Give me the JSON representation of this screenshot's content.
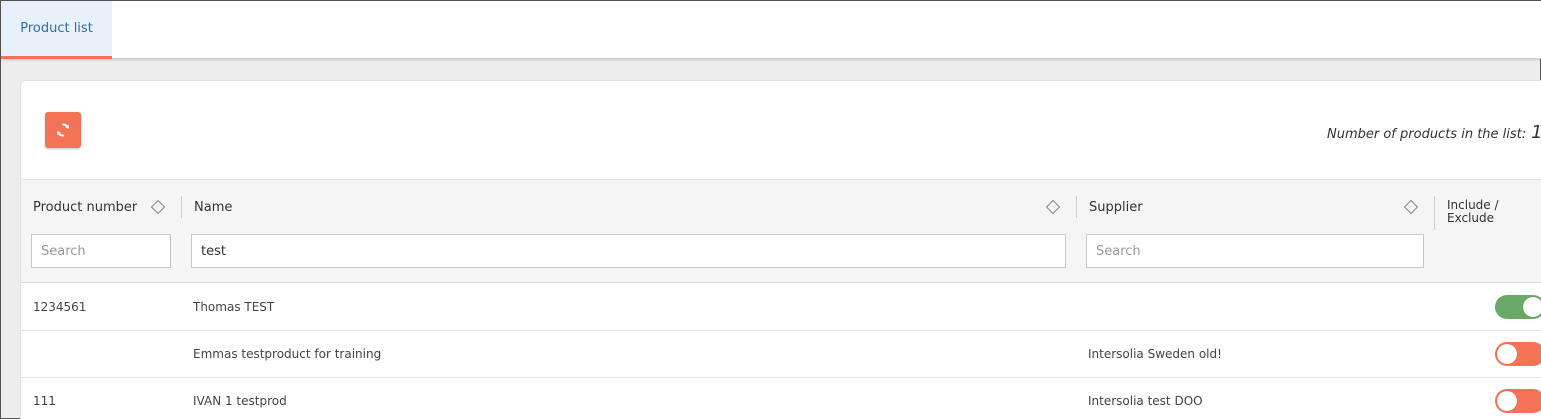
{
  "tabs": [
    {
      "label": "Product list",
      "active": true
    }
  ],
  "toolbar": {
    "refresh_icon": "refresh-icon",
    "count_label": "Number of products in the list:",
    "count_value": "1"
  },
  "columns": {
    "product_number": {
      "label": "Product number",
      "search_value": "",
      "search_placeholder": "Search"
    },
    "name": {
      "label": "Name",
      "search_value": "test",
      "search_placeholder": "Search"
    },
    "supplier": {
      "label": "Supplier",
      "search_value": "",
      "search_placeholder": "Search"
    },
    "include": {
      "label_line1": "Include /",
      "label_line2": "Exclude"
    }
  },
  "rows": [
    {
      "product_number": "1234561",
      "name": "Thomas TEST",
      "supplier": "",
      "included": true
    },
    {
      "product_number": "",
      "name": "Emmas testproduct for training",
      "supplier": "Intersolia Sweden old!",
      "included": false
    },
    {
      "product_number": "111",
      "name": "IVAN 1 testprod",
      "supplier": "Intersolia test DOO",
      "included": false
    }
  ],
  "colors": {
    "accent": "#f47356",
    "tab_text": "#2a6fb2",
    "toggle_on": "#6aa866",
    "toggle_off": "#f47356"
  }
}
